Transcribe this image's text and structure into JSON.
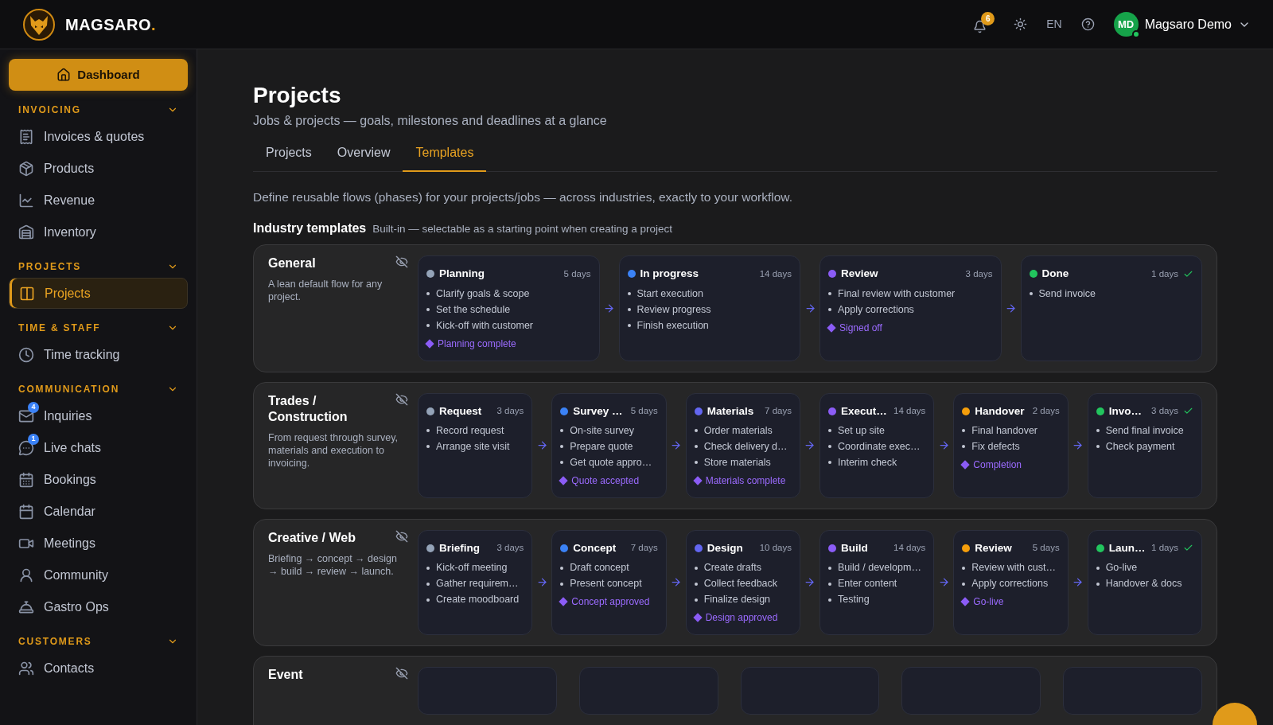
{
  "brand": {
    "name": "MAGSARO",
    "suffix": "."
  },
  "topbar": {
    "notifications": "6",
    "language": "EN",
    "user": {
      "initials": "MD",
      "name": "Magsaro Demo",
      "online": true
    }
  },
  "sidebar": {
    "dashboard": "Dashboard",
    "sections": [
      {
        "title": "INVOICING",
        "expanded": true,
        "items": [
          {
            "label": "Invoices & quotes",
            "selected": false
          },
          {
            "label": "Products",
            "selected": false
          },
          {
            "label": "Revenue",
            "selected": false
          },
          {
            "label": "Inventory",
            "selected": false
          }
        ]
      },
      {
        "title": "PROJECTS",
        "expanded": true,
        "items": [
          {
            "label": "Projects",
            "selected": true
          }
        ]
      },
      {
        "title": "TIME & STAFF",
        "expanded": true,
        "items": [
          {
            "label": "Time tracking",
            "selected": false
          }
        ]
      },
      {
        "title": "COMMUNICATION",
        "expanded": true,
        "items": [
          {
            "label": "Inquiries",
            "selected": false,
            "badge": "4"
          },
          {
            "label": "Live chats",
            "selected": false,
            "badge": "1"
          },
          {
            "label": "Bookings",
            "selected": false
          },
          {
            "label": "Calendar",
            "selected": false
          },
          {
            "label": "Meetings",
            "selected": false
          },
          {
            "label": "Community",
            "selected": false
          },
          {
            "label": "Gastro Ops",
            "selected": false
          }
        ]
      },
      {
        "title": "CUSTOMERS",
        "expanded": true,
        "items": [
          {
            "label": "Contacts",
            "selected": false
          }
        ]
      }
    ]
  },
  "page": {
    "title": "Projects",
    "subtitle": "Jobs & projects — goals, milestones and deadlines at a glance",
    "tabs": [
      {
        "label": "Projects",
        "selected": false
      },
      {
        "label": "Overview",
        "selected": false
      },
      {
        "label": "Templates",
        "selected": true
      }
    ],
    "intro": "Define reusable flows (phases) for your projects/jobs — across industries, exactly to your workflow.",
    "section_title": "Industry templates",
    "section_note": "Built-in — selectable as a starting point when creating a project"
  },
  "templates": [
    {
      "name": "General",
      "description": "A lean default flow for any project.",
      "phases": [
        {
          "name": "Planning",
          "duration": "5 days",
          "color": "#94a3b8",
          "tasks": [
            "Clarify goals & scope",
            "Set the schedule",
            "Kick-off with customer"
          ],
          "milestone": "Planning complete",
          "final": false
        },
        {
          "name": "In progress",
          "duration": "14 days",
          "color": "#3b82f6",
          "tasks": [
            "Start execution",
            "Review progress",
            "Finish execution"
          ],
          "final": false
        },
        {
          "name": "Review",
          "duration": "3 days",
          "color": "#8b5cf6",
          "tasks": [
            "Final review with customer",
            "Apply corrections"
          ],
          "milestone": "Signed off",
          "final": false
        },
        {
          "name": "Done",
          "duration": "1 days",
          "color": "#22c55e",
          "tasks": [
            "Send invoice"
          ],
          "final": true
        }
      ]
    },
    {
      "name": "Trades / Construction",
      "description": "From request through survey, materials and execution to invoicing.",
      "phases": [
        {
          "name": "Request",
          "duration": "3 days",
          "color": "#94a3b8",
          "tasks": [
            "Record request",
            "Arrange site visit"
          ],
          "final": false
        },
        {
          "name": "Survey …",
          "duration": "5 days",
          "color": "#3b82f6",
          "tasks": [
            "On-site survey",
            "Prepare quote",
            "Get quote appro…"
          ],
          "milestone": "Quote accepted",
          "final": false
        },
        {
          "name": "Materials",
          "duration": "7 days",
          "color": "#6366f1",
          "tasks": [
            "Order materials",
            "Check delivery d…",
            "Store materials"
          ],
          "milestone": "Materials complete",
          "final": false
        },
        {
          "name": "Execut…",
          "duration": "14 days",
          "color": "#8b5cf6",
          "tasks": [
            "Set up site",
            "Coordinate exec…",
            "Interim check"
          ],
          "final": false
        },
        {
          "name": "Handover",
          "duration": "2 days",
          "color": "#f59e0b",
          "tasks": [
            "Final handover",
            "Fix defects"
          ],
          "milestone": "Completion",
          "final": false
        },
        {
          "name": "Invo…",
          "duration": "3 days",
          "color": "#22c55e",
          "tasks": [
            "Send final invoice",
            "Check payment"
          ],
          "final": true
        }
      ]
    },
    {
      "name": "Creative / Web",
      "description": "Briefing → concept → design → build → review → launch.",
      "phases": [
        {
          "name": "Briefing",
          "duration": "3 days",
          "color": "#94a3b8",
          "tasks": [
            "Kick-off meeting",
            "Gather requirem…",
            "Create moodboard"
          ],
          "final": false
        },
        {
          "name": "Concept",
          "duration": "7 days",
          "color": "#3b82f6",
          "tasks": [
            "Draft concept",
            "Present concept"
          ],
          "milestone": "Concept approved",
          "final": false
        },
        {
          "name": "Design",
          "duration": "10 days",
          "color": "#6366f1",
          "tasks": [
            "Create drafts",
            "Collect feedback",
            "Finalize design"
          ],
          "milestone": "Design approved",
          "final": false
        },
        {
          "name": "Build",
          "duration": "14 days",
          "color": "#8b5cf6",
          "tasks": [
            "Build / developm…",
            "Enter content",
            "Testing"
          ],
          "final": false
        },
        {
          "name": "Review",
          "duration": "5 days",
          "color": "#f59e0b",
          "tasks": [
            "Review with cust…",
            "Apply corrections"
          ],
          "milestone": "Go-live",
          "final": false
        },
        {
          "name": "Laun…",
          "duration": "1 days",
          "color": "#22c55e",
          "tasks": [
            "Go-live",
            "Handover & docs"
          ],
          "final": true
        }
      ]
    },
    {
      "name": "Event"
    }
  ]
}
